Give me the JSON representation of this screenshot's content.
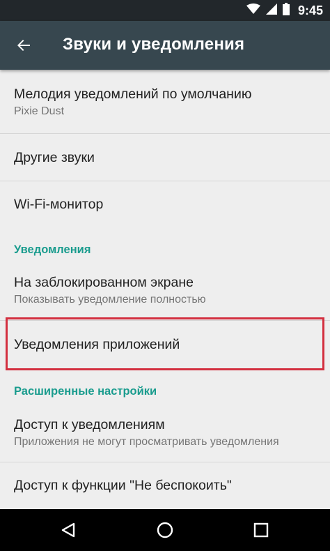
{
  "status_bar": {
    "time": "9:45",
    "icons": [
      "wifi-icon",
      "signal-icon",
      "battery-icon"
    ]
  },
  "toolbar": {
    "back_icon": "arrow-back-icon",
    "title": "Звуки и уведомления"
  },
  "items": {
    "default_ringtone": {
      "title": "Мелодия уведомлений по умолчанию",
      "summary": "Pixie Dust"
    },
    "other_sounds": {
      "title": "Другие звуки"
    },
    "wifi_monitor": {
      "title": "Wi-Fi-монитор"
    },
    "notifications_category": "Уведомления",
    "lock_screen": {
      "title": "На заблокированном экране",
      "summary": "Показывать уведомление полностью"
    },
    "app_notifications": {
      "title": "Уведомления приложений"
    },
    "advanced_category": "Расширенные настройки",
    "notification_access": {
      "title": "Доступ к уведомлениям",
      "summary": "Приложения не могут просматривать уведомления"
    },
    "dnd_access": {
      "title": "Доступ к функции \"Не беспокоить\""
    }
  },
  "nav_bar": {
    "icons": [
      "back-triangle-icon",
      "home-circle-icon",
      "recents-square-icon"
    ]
  },
  "colors": {
    "status_bar": "#22272B",
    "toolbar": "#37474F",
    "category": "#1A9C8E",
    "highlight": "#D32F3F",
    "background": "#EEEEEE"
  }
}
